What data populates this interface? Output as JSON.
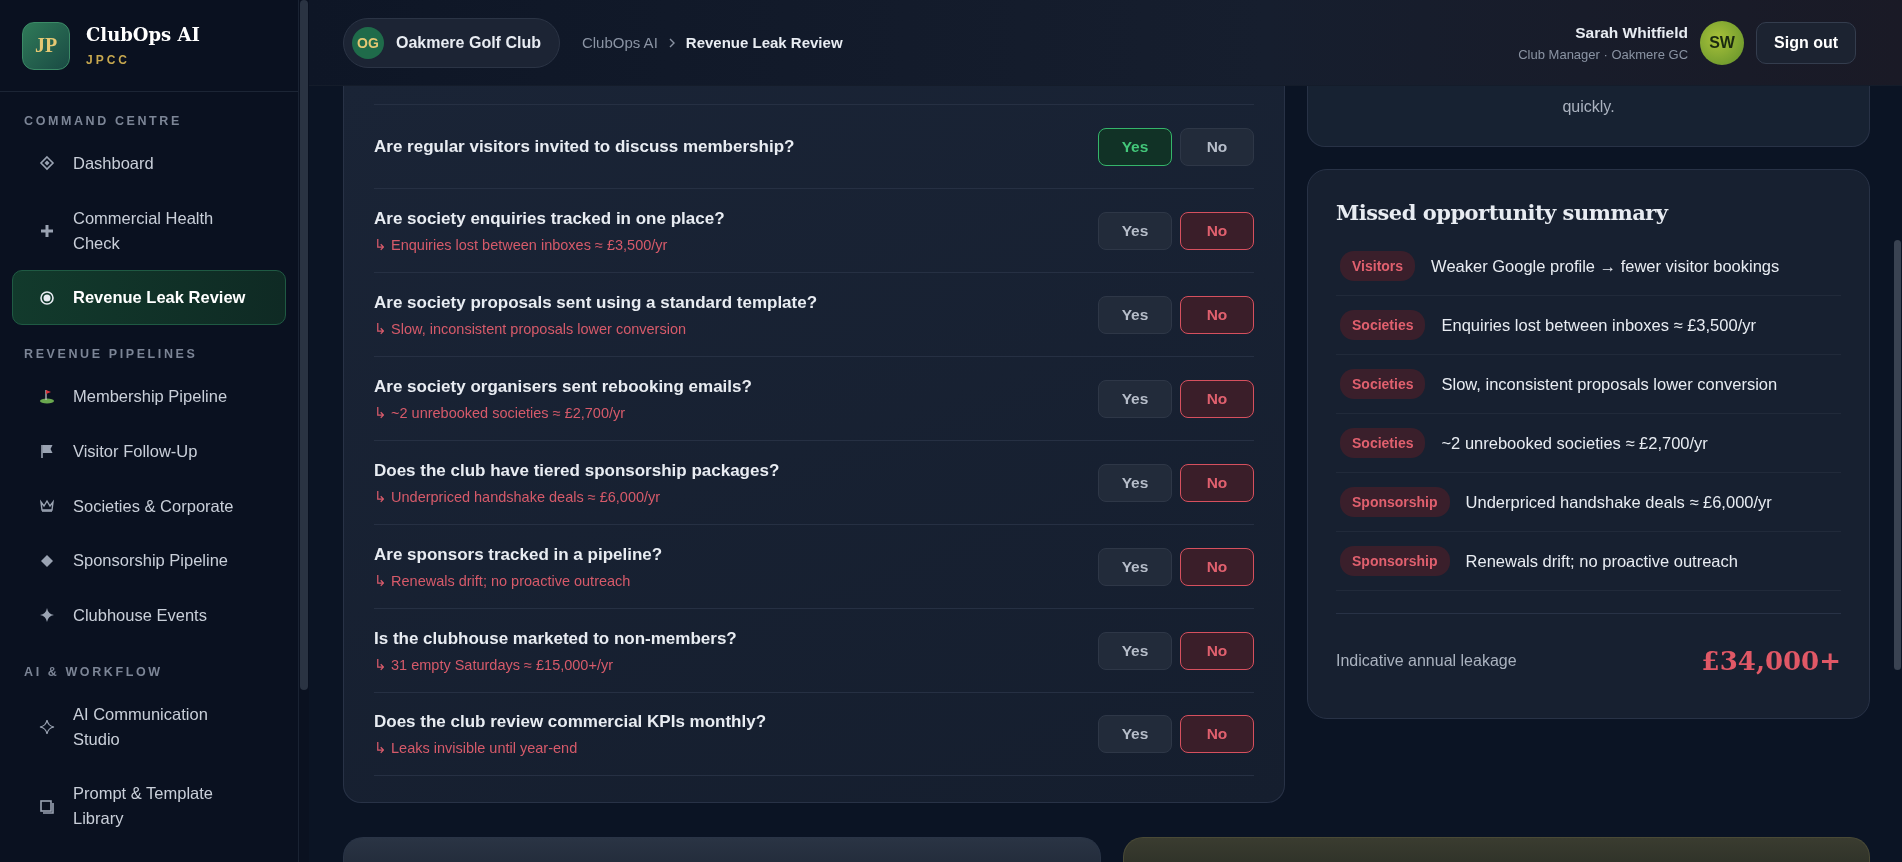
{
  "brand": {
    "logo": "JP",
    "name": "ClubOps AI",
    "tagline": "JPCC"
  },
  "sidebar": {
    "sections": [
      {
        "title": "COMMAND CENTRE",
        "items": [
          {
            "kind": "diamond-outline",
            "label": "Dashboard",
            "selected": false
          },
          {
            "kind": "plus",
            "label": "Commercial Health Check",
            "selected": false
          },
          {
            "kind": "target",
            "label": "Revenue Leak Review",
            "selected": true
          }
        ]
      },
      {
        "title": "REVENUE PIPELINES",
        "items": [
          {
            "kind": "golf-flag",
            "label": "Membership Pipeline",
            "selected": false
          },
          {
            "kind": "flag",
            "label": "Visitor Follow-Up",
            "selected": false
          },
          {
            "kind": "crown",
            "label": "Societies & Corporate",
            "selected": false
          },
          {
            "kind": "diamond",
            "label": "Sponsorship Pipeline",
            "selected": false
          },
          {
            "kind": "sparkle",
            "label": "Clubhouse Events",
            "selected": false
          }
        ]
      },
      {
        "title": "AI & WORKFLOW",
        "items": [
          {
            "kind": "sparkle-outline",
            "label": "AI Communication Studio",
            "selected": false
          },
          {
            "kind": "square",
            "label": "Prompt & Template Library",
            "selected": false
          }
        ]
      }
    ]
  },
  "header": {
    "club": {
      "initials": "OG",
      "name": "Oakmere Golf Club"
    },
    "breadcrumb": [
      "ClubOps AI",
      "Revenue Leak Review"
    ],
    "user": {
      "name": "Sarah Whitfield",
      "role": "Club Manager · Oakmere GC",
      "initials": "SW"
    },
    "sign_out": "Sign out"
  },
  "questions": [
    {
      "question": "Are regular visitors invited to discuss membership?",
      "options": [
        {
          "label": "Yes",
          "selected": true
        },
        {
          "label": "No",
          "selected": false
        }
      ]
    },
    {
      "question": "Are society enquiries tracked in one place?",
      "note": "↳ Enquiries lost between inboxes ≈ £3,500/yr",
      "options": [
        {
          "label": "Yes",
          "selected": false
        },
        {
          "label": "No",
          "selected": true
        }
      ]
    },
    {
      "question": "Are society proposals sent using a standard template?",
      "note": "↳ Slow, inconsistent proposals lower conversion",
      "options": [
        {
          "label": "Yes",
          "selected": false
        },
        {
          "label": "No",
          "selected": true
        }
      ]
    },
    {
      "question": "Are society organisers sent rebooking emails?",
      "note": "↳ ~2 unrebooked societies ≈ £2,700/yr",
      "options": [
        {
          "label": "Yes",
          "selected": false
        },
        {
          "label": "No",
          "selected": true
        }
      ]
    },
    {
      "question": "Does the club have tiered sponsorship packages?",
      "note": "↳ Underpriced handshake deals ≈ £6,000/yr",
      "options": [
        {
          "label": "Yes",
          "selected": false
        },
        {
          "label": "No",
          "selected": true
        }
      ]
    },
    {
      "question": "Are sponsors tracked in a pipeline?",
      "note": "↳ Renewals drift; no proactive outreach",
      "options": [
        {
          "label": "Yes",
          "selected": false
        },
        {
          "label": "No",
          "selected": true
        }
      ]
    },
    {
      "question": "Is the clubhouse marketed to non-members?",
      "note": "↳ 31 empty Saturdays ≈ £15,000+/yr",
      "options": [
        {
          "label": "Yes",
          "selected": false
        },
        {
          "label": "No",
          "selected": true
        }
      ]
    },
    {
      "question": "Does the club review commercial KPIs monthly?",
      "note": "↳ Leaks invisible until year-end",
      "options": [
        {
          "label": "Yes",
          "selected": false
        },
        {
          "label": "No",
          "selected": true
        }
      ]
    }
  ],
  "assessment": {
    "text": "quickly."
  },
  "summary": {
    "title": "Missed opportunity summary",
    "items": [
      {
        "tag": "Visitors",
        "text": "Weaker Google profile → fewer visitor bookings"
      },
      {
        "tag": "Societies",
        "text": "Enquiries lost between inboxes ≈ £3,500/yr"
      },
      {
        "tag": "Societies",
        "text": "Slow, inconsistent proposals lower conversion"
      },
      {
        "tag": "Societies",
        "text": "~2 unrebooked societies ≈ £2,700/yr"
      },
      {
        "tag": "Sponsorship",
        "text": "Underpriced handshake deals ≈ £6,000/yr"
      },
      {
        "tag": "Sponsorship",
        "text": "Renewals drift; no proactive outreach"
      }
    ],
    "total_label": "Indicative annual leakage",
    "total_value": "£34,000+"
  }
}
